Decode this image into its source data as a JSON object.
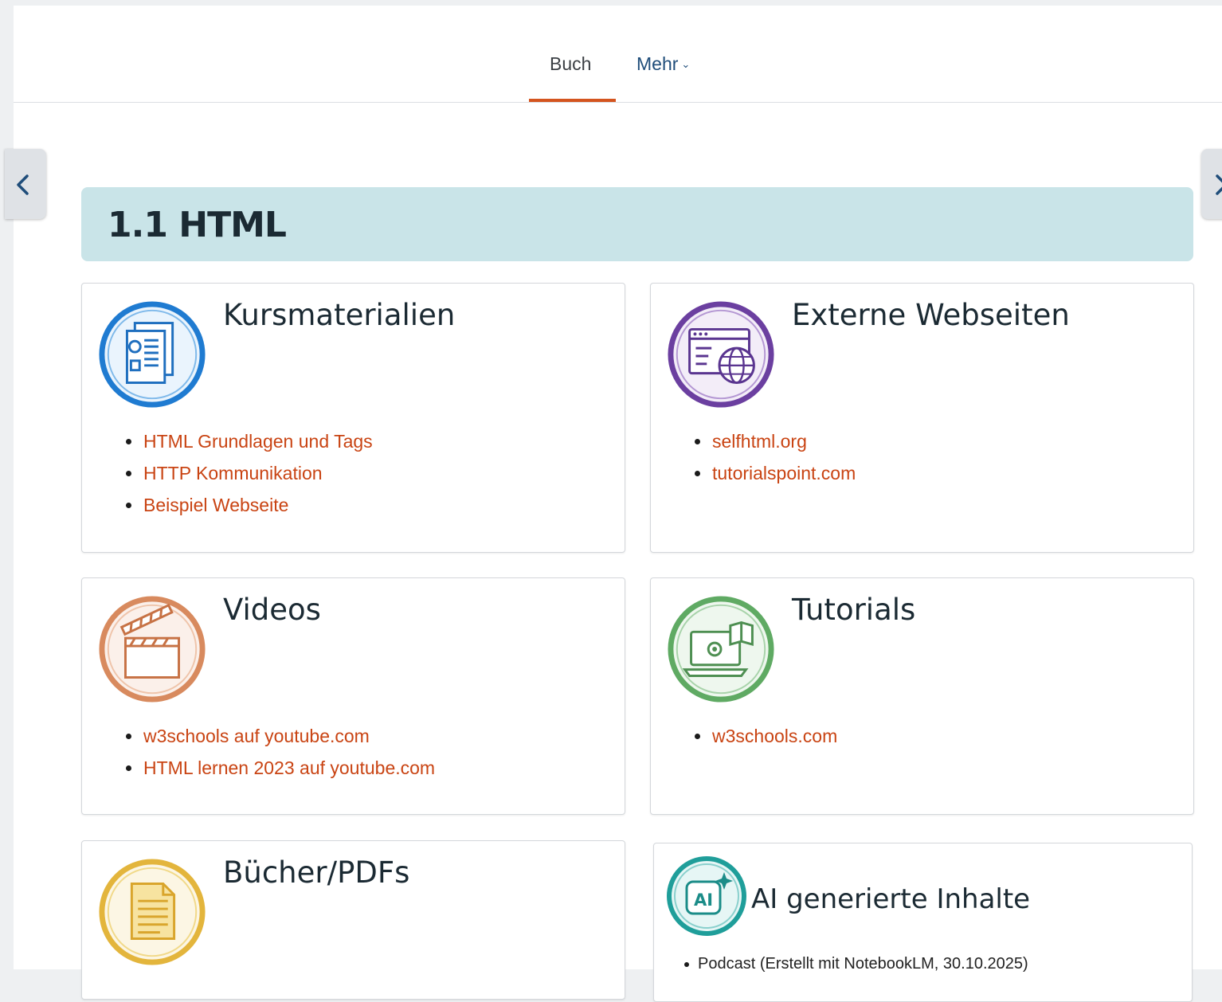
{
  "nav": {
    "tabs": [
      {
        "label": "Buch",
        "active": true
      },
      {
        "label": "Mehr",
        "has_dropdown": true
      }
    ],
    "active_color": "#d4541e",
    "prev_icon": "chevron-left-icon",
    "next_icon": "chevron-right-icon"
  },
  "section": {
    "title": "1.1 HTML",
    "background": "#c9e4e8"
  },
  "cards": [
    {
      "title": "Kursmaterialien",
      "icon": "documents-icon",
      "color": "#1f7bd1",
      "links": [
        "HTML Grundlagen und Tags",
        "HTTP Kommunikation",
        "Beispiel Webseite"
      ]
    },
    {
      "title": "Externe Webseiten",
      "icon": "browser-globe-icon",
      "color": "#6b3fa0",
      "links": [
        "selfhtml.org",
        "tutorialspoint.com"
      ]
    },
    {
      "title": "Videos",
      "icon": "clapperboard-icon",
      "color": "#d88a5e",
      "links": [
        "w3schools auf youtube.com",
        "HTML lernen 2023 auf youtube.com"
      ]
    },
    {
      "title": "Tutorials",
      "icon": "laptop-book-icon",
      "color": "#5faa63",
      "links": [
        "w3schools.com"
      ]
    },
    {
      "title": "Bücher/PDFs",
      "icon": "document-icon",
      "color": "#e3b53c",
      "links": []
    },
    {
      "title": "AI generierte Inhalte",
      "icon": "ai-sparkle-icon",
      "color": "#1f9e9a",
      "items": [
        "Podcast (Erstellt mit NotebookLM, 30.10.2025)"
      ]
    }
  ],
  "link_color": "#c94413"
}
